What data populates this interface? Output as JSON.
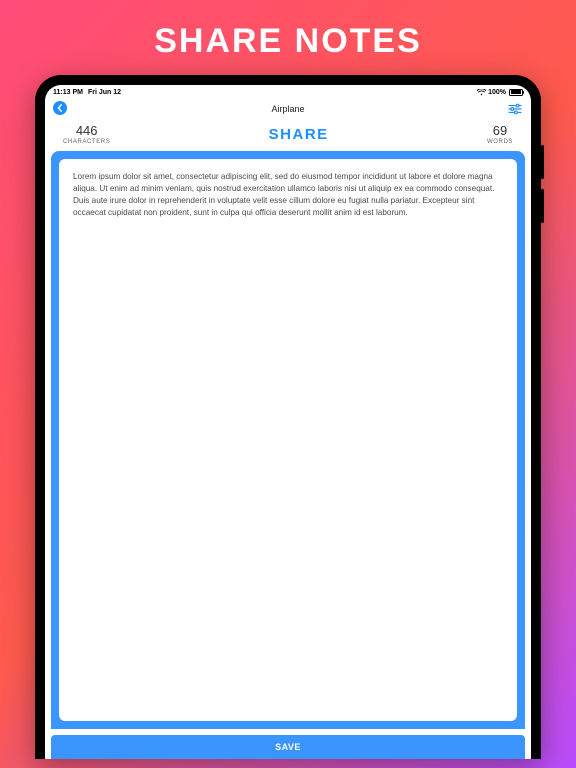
{
  "promo": {
    "title": "SHARE NOTES"
  },
  "statusbar": {
    "time": "11:13 PM",
    "date": "Fri Jun 12",
    "battery": "100%"
  },
  "navbar": {
    "title": "Airplane"
  },
  "counts": {
    "characters_value": "446",
    "characters_label": "CHARACTERS",
    "words_value": "69",
    "words_label": "WORDS"
  },
  "share": {
    "label": "SHARE"
  },
  "editor": {
    "text": "Lorem ipsum dolor sit amet, consectetur adipiscing elit, sed do eiusmod tempor incididunt ut labore et dolore magna aliqua. Ut enim ad minim veniam, quis nostrud exercitation ullamco laboris nisi ut aliquip ex ea commodo consequat. Duis aute irure dolor in reprehenderit in voluptate velit esse cillum dolore eu fugiat nulla pariatur. Excepteur sint occaecat cupidatat non proident, sunt in culpa qui officia deserunt mollit anim id est laborum."
  },
  "save": {
    "label": "SAVE"
  }
}
